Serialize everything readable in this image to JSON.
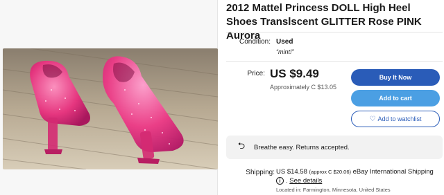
{
  "listing": {
    "title": "2012 Mattel Princess DOLL High Heel Shoes Translscent GLITTER Rose PINK Aurora"
  },
  "condition": {
    "label": "Condition:",
    "value": "Used",
    "note": "“mint!”"
  },
  "price": {
    "label": "Price:",
    "value": "US $9.49",
    "approx": "Approximately C $13.05"
  },
  "actions": {
    "buy_now": "Buy It Now",
    "add_to_cart": "Add to cart",
    "add_to_watchlist": "Add to watchlist"
  },
  "returns": {
    "text": "Breathe easy. Returns accepted."
  },
  "shipping": {
    "label": "Shipping:",
    "price": "US $14.58",
    "approx": "(approx C $20.06)",
    "service": "eBay International Shipping",
    "see_details": "See details",
    "location": "Located in: Farmington, Minnesota, United States"
  },
  "colors": {
    "primary_button": "#2a5cb8",
    "secondary_button": "#4b9fe3",
    "shoe_pink": "#e8307e"
  }
}
